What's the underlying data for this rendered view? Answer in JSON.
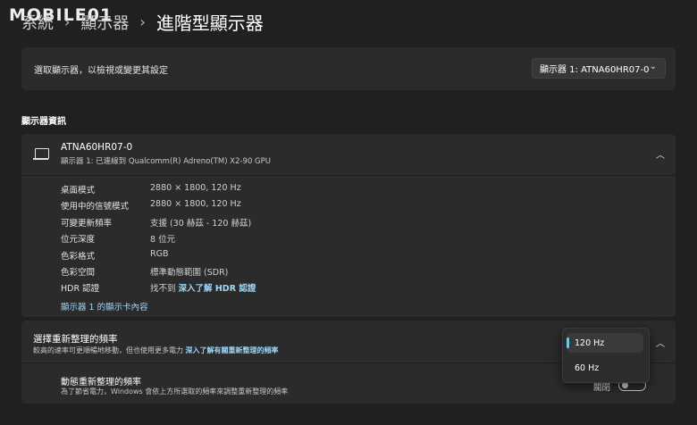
{
  "watermark": "MOBILE01",
  "breadcrumb": {
    "item1": "系統",
    "item2": "顯示器",
    "current": "進階型顯示器"
  },
  "select_card": {
    "label": "選取顯示器，以檢視或變更其設定",
    "dropdown_value": "顯示器 1: ATNA60HR07-0"
  },
  "section_title": "顯示器資訊",
  "info": {
    "name": "ATNA60HR07-0",
    "sub": "顯示器 1: 已連線到 Qualcomm(R) Adreno(TM) X2-90 GPU",
    "rows": [
      {
        "k": "桌面模式",
        "v": "2880 × 1800, 120 Hz"
      },
      {
        "k": "使用中的信號模式",
        "v": "2880 × 1800, 120 Hz"
      },
      {
        "k": "可變更新頻率",
        "v": "支援 (30 赫茲 - 120 赫茲)"
      },
      {
        "k": "位元深度",
        "v": "8 位元"
      },
      {
        "k": "色彩格式",
        "v": "RGB"
      },
      {
        "k": "色彩空間",
        "v": "標準動態範圍 (SDR)"
      },
      {
        "k": "HDR 認證",
        "v": "找不到",
        "link": "深入了解 HDR 認證"
      }
    ],
    "adapter_link": "顯示器 1 的顯示卡內容"
  },
  "refresh": {
    "title": "選擇重新整理的頻率",
    "desc": "較高的速率可更順暢地移動，但也使用更多電力",
    "desc_link": "深入了解有關重新整理的頻率",
    "options": [
      "120 Hz",
      "60 Hz"
    ],
    "dynamic_title": "動態重新整理的頻率",
    "dynamic_desc": "為了節省電力，Windows 會依上方所選取的頻率來調整重新整理的頻率",
    "toggle_label": "關閉"
  },
  "colors": {
    "accent": "#76c4f0",
    "link": "#9fd5f5",
    "background": "#202020",
    "card": "#2b2b2b"
  }
}
